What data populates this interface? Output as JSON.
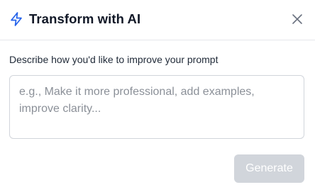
{
  "header": {
    "icon": "lightning-bolt-icon",
    "title": "Transform with AI",
    "close_icon": "close-icon"
  },
  "form": {
    "label": "Describe how you'd like to improve your prompt",
    "value": "",
    "placeholder": "e.g., Make it more professional, add examples, improve clarity..."
  },
  "actions": {
    "generate_label": "Generate"
  },
  "colors": {
    "accent": "#2563eb",
    "disabled_button": "#d1d5db",
    "placeholder_text": "#8b9098",
    "border": "#d1d5db"
  }
}
